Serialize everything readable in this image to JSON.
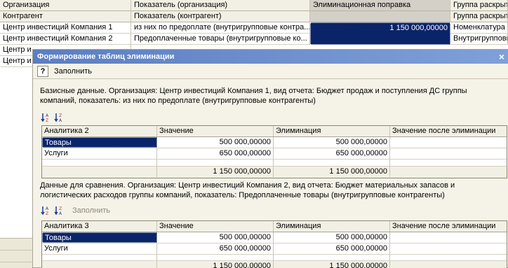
{
  "background_table": {
    "headers_row1": [
      "Организация",
      "Показатель (организация)",
      "Элиминационная поправка",
      "Группа раскрыт"
    ],
    "headers_row2": [
      "Контрагент",
      "Показатель (контрагент)",
      "",
      "Группа раскрыт"
    ],
    "rows": [
      [
        "Центр инвестиций Компания 1",
        "из них по предоплате (внутригрупповые контра...",
        "1 150 000,00000",
        "Номенклатура"
      ],
      [
        "Центр инвестиций Компания 2",
        "Предоплаченные товары (внутригрупповые ко...",
        "",
        "Внутригрупповые"
      ],
      [
        "Центр и",
        "",
        "",
        ""
      ],
      [
        "Центр и",
        "",
        "",
        ""
      ]
    ]
  },
  "dialog": {
    "title": "Формирование таблиц элиминации",
    "close_glyph": "×",
    "toolbar": {
      "help_glyph": "?",
      "fill_label": "Заполнить"
    },
    "section1": {
      "description": "Базисные данные. Организация: Центр инвестиций Компания 1, вид отчета: Бюджет продаж и поступления ДС группы компаний, показатель: из них по предоплате (внутригрупповые контрагенты)",
      "columns": [
        "Аналитика 2",
        "Значение",
        "Элиминация",
        "Значение после элиминации"
      ],
      "rows": [
        [
          "Товары",
          "500 000,00000",
          "500 000,00000",
          ""
        ],
        [
          "Услуги",
          "650 000,00000",
          "650 000,00000",
          ""
        ]
      ],
      "totals": [
        "",
        "1 150 000,00000",
        "1 150 000,00000",
        ""
      ]
    },
    "section2": {
      "description": "Данные для сравнения. Организация: Центр инвестиций Компания 2, вид отчета: Бюджет материальных запасов и логистических расходов группы компаний, показатель: Предоплаченные товары (внутригрупповые контрагенты)",
      "fill_label": "Заполнить",
      "columns": [
        "Аналитика 3",
        "Значение",
        "Элиминация",
        "Значение после элиминации"
      ],
      "rows": [
        [
          "Товары",
          "500 000,00000",
          "500 000,00000",
          ""
        ],
        [
          "Услуги",
          "650 000,00000",
          "650 000,00000",
          ""
        ]
      ],
      "totals": [
        "",
        "1 150 000,00000",
        "1 150 000,00000",
        ""
      ]
    }
  },
  "colors": {
    "selection": "#0a246a",
    "title_bar": "#5c7ec0",
    "panel": "#f5f3e8"
  },
  "icons": [
    "sort-ascending-icon",
    "sort-descending-icon",
    "help-icon",
    "close-icon"
  ]
}
